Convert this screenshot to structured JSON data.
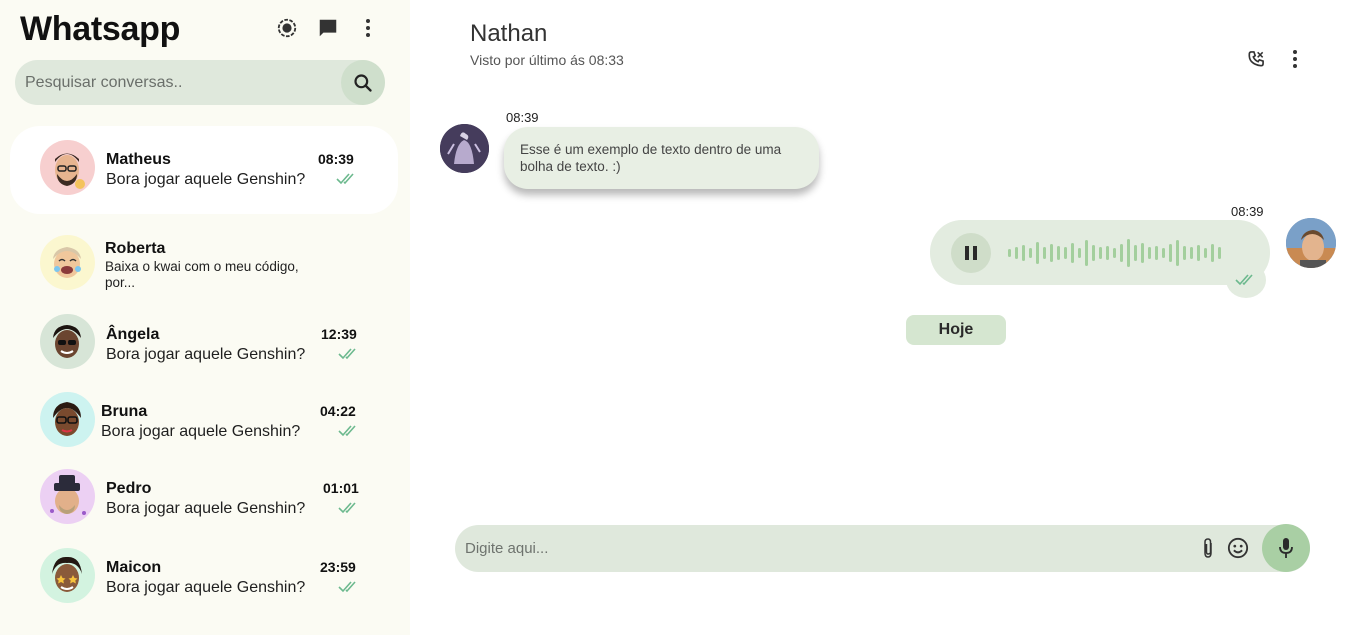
{
  "app": {
    "title": "Whatsapp"
  },
  "icons": {
    "status": "status-circle-icon",
    "chat": "chat-bubble-icon",
    "menu": "more-vertical-icon",
    "search": "search-icon",
    "call": "phone-call-icon",
    "attach": "paperclip-icon",
    "emoji": "smiley-icon",
    "mic": "microphone-icon"
  },
  "colors": {
    "sidebar_bg": "#fbfbf3",
    "accent": "#a9cfa4",
    "bubble": "#e8efe4",
    "tick": "#6cb98e"
  },
  "search": {
    "placeholder": "Pesquisar conversas.."
  },
  "chats": [
    {
      "name": "Matheus",
      "message": "Bora jogar aquele Genshin?",
      "time": "08:39",
      "read": true,
      "avatar_bg": "#f7cfcf"
    },
    {
      "name": "Roberta",
      "message": "Baixa o kwai com o meu código, por...",
      "time": "",
      "read": false,
      "avatar_bg": "#fbf7cf"
    },
    {
      "name": "Ângela",
      "message": "Bora jogar aquele Genshin?",
      "time": "12:39",
      "read": true,
      "avatar_bg": "#d7e5d7"
    },
    {
      "name": "Bruna",
      "message": "Bora jogar aquele Genshin?",
      "time": "04:22",
      "read": true,
      "avatar_bg": "#cdf3f0"
    },
    {
      "name": "Pedro",
      "message": "Bora jogar aquele Genshin?",
      "time": "01:01",
      "read": true,
      "avatar_bg": "#ecd0f3"
    },
    {
      "name": "Maicon",
      "message": "Bora jogar aquele Genshin?",
      "time": "23:59",
      "read": true,
      "avatar_bg": "#d3f3e0"
    }
  ],
  "conversation": {
    "contact_name": "Nathan",
    "last_seen": "Visto por último ás 08:33",
    "messages": [
      {
        "direction": "in",
        "time": "08:39",
        "text": "Esse é um exemplo de texto dentro de uma bolha de texto. :)"
      },
      {
        "direction": "out",
        "time": "08:39",
        "type": "audio",
        "playing": true,
        "read": true
      }
    ],
    "day_label": "Hoje"
  },
  "composer": {
    "placeholder": "Digite aqui..."
  }
}
